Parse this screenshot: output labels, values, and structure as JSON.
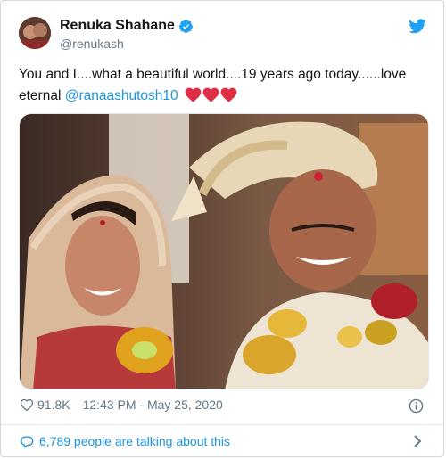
{
  "tweet": {
    "author": {
      "display_name": "Renuka Shahane",
      "handle": "@renukash",
      "verified": true
    },
    "text": {
      "line": "You and I....what a beautiful world....19 years ago today......love eternal ",
      "mention": "@ranaashutosh10",
      "emoji": [
        "red-heart",
        "red-heart",
        "red-heart"
      ]
    },
    "media": {
      "alt": ""
    },
    "likes": "91.8K",
    "timestamp": "12:43 PM - May 25, 2020",
    "conversation": "6,789 people are talking about this"
  },
  "colors": {
    "link": "#1b95e0",
    "heart": "#e0245e",
    "secondary": "#657786",
    "twitter_blue": "#1da1f2"
  },
  "icons": [
    "twitter-bird-icon",
    "verified-badge-icon",
    "like-icon",
    "info-icon",
    "speech-bubble-icon",
    "chevron-right-icon"
  ]
}
